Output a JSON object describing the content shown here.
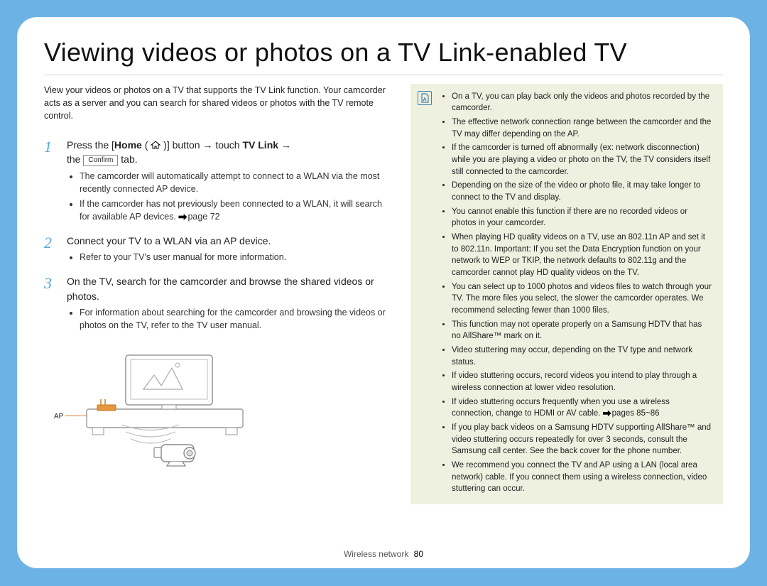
{
  "title": "Viewing videos or photos on a TV Link-enabled TV",
  "intro": "View your videos or photos on a TV that supports the TV Link function. Your camcorder acts as a server and you can search for shared videos or photos with the TV remote control.",
  "steps": {
    "s1": {
      "num": "1",
      "pre": "Press the [",
      "home": "Home",
      "mid1": " ( ",
      "mid2": " )] button ",
      "arrow1": "→",
      "touch": " touch ",
      "tvlink": "TV Link",
      "arrow2": " → ",
      "the": "the ",
      "confirm": "Confirm",
      "tab": " tab.",
      "b1": "The camcorder will automatically attempt to connect to a WLAN via the most recently connected AP device.",
      "b2_a": "If the camcorder has not previously been connected to a WLAN, it will search for available AP devices. ",
      "b2_ref": "page 72"
    },
    "s2": {
      "num": "2",
      "text": "Connect your TV to a WLAN via an AP device.",
      "b1": "Refer to your TV's user manual for more information."
    },
    "s3": {
      "num": "3",
      "text": "On the TV, search for the camcorder and browse the shared videos or photos.",
      "b1": "For information about searching for the camcorder and browsing the videos or photos on the TV, refer to the TV user manual."
    }
  },
  "illus": {
    "ap_label": "AP"
  },
  "notes": {
    "n1": "On a TV, you can play back only the videos and photos recorded by the camcorder.",
    "n2": "The effective network connection range between the camcorder and the TV may differ depending on the AP.",
    "n3": "If the camcorder is turned off abnormally (ex: network disconnection) while you are playing a video or photo on the TV, the TV considers itself still connected to the camcorder.",
    "n4": "Depending on the size of the video or photo file, it may take longer to connect to the TV and display.",
    "n5": "You cannot enable this function if there are no recorded videos or photos in your camcorder.",
    "n6": "When playing HD quality videos on a TV, use an 802.11n AP and set it to 802.11n. Important: If you set the Data Encryption function on your network to WEP or TKIP, the network defaults to 802.11g and the camcorder cannot play HD quality videos on the TV.",
    "n7": "You can select up to 1000 photos and videos files to watch through your TV. The more files you select, the slower the camcorder operates. We recommend selecting fewer than 1000 files.",
    "n8": "This function may not operate properly on a Samsung HDTV that has no AllShare™ mark on it.",
    "n9": "Video stuttering may occur, depending on the TV type and network status.",
    "n10": "If video stuttering occurs, record videos you intend to play through a wireless connection at lower video resolution.",
    "n11_a": "If video stuttering occurs frequently when you use a wireless connection, change to HDMI or AV cable. ",
    "n11_ref": "pages 85~86",
    "n12": "If you play back videos on a Samsung HDTV supporting AllShare™ and video stuttering occurs repeatedly for over 3 seconds, consult the Samsung call center. See the back cover for the phone number.",
    "n13": "We recommend you connect the TV and AP using a LAN (local area network) cable. If you connect them using a wireless connection, video stuttering can occur."
  },
  "footer": {
    "section": "Wireless network",
    "page": "80"
  }
}
